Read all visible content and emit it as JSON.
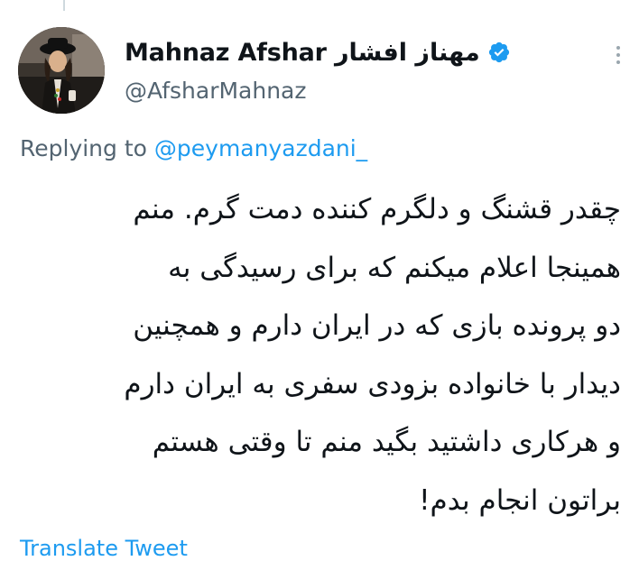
{
  "tweet": {
    "author": {
      "display_name": "Mahnaz Afshar مهناز افشار",
      "handle": "@AfsharMahnaz",
      "verified": true,
      "avatar": "profile-photo"
    },
    "more_icon": "more-vertical-icon",
    "reply_prefix": "Replying to",
    "reply_mention": "@peymanyazdani_",
    "body_lines": [
      "چقدر قشنگ و دلگرم کننده دمت گرم. منم",
      "همینجا اعلام میکنم که برای رسیدگی به",
      "دو پرونده بازی که در ایران دارم و همچنین",
      "دیدار با خانواده بزودی سفری به ایران دارم",
      "و هرکاری داشتید بگید منم تا وقتی هستم",
      "براتون انجام بدم!"
    ],
    "translate_label": "Translate Tweet"
  },
  "colors": {
    "text_primary": "#0f1419",
    "text_secondary": "#536471",
    "accent": "#1d9bf0",
    "background": "#ffffff"
  }
}
